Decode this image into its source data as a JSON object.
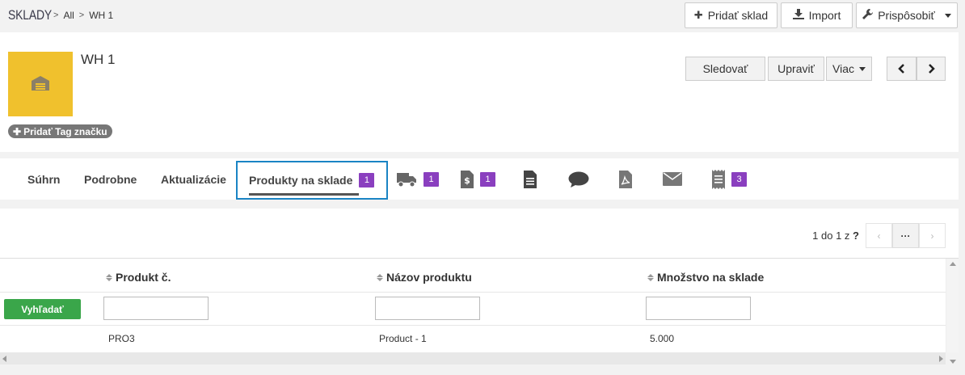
{
  "breadcrumb": {
    "module": "SKLADY",
    "all": "All",
    "current": "WH 1"
  },
  "toolbar": {
    "add_label": "Pridať sklad",
    "import_label": "Import",
    "customize_label": "Prispôsobiť"
  },
  "record": {
    "title": "WH 1",
    "tag_label": "Pridať Tag značku",
    "follow_label": "Sledovať",
    "edit_label": "Upraviť",
    "more_label": "Viac"
  },
  "tabs": [
    {
      "label": "Súhrn"
    },
    {
      "label": "Podrobne"
    },
    {
      "label": "Aktualizácie"
    },
    {
      "label": "Produkty na sklade",
      "badge": "1"
    },
    {
      "icon": "truck-icon",
      "badge": "1"
    },
    {
      "icon": "invoice-icon",
      "badge": "1"
    },
    {
      "icon": "document-icon"
    },
    {
      "icon": "comment-icon"
    },
    {
      "icon": "pdf-icon"
    },
    {
      "icon": "envelope-icon"
    },
    {
      "icon": "receipt-icon",
      "badge": "3"
    }
  ],
  "pager": {
    "text": "1 do 1  z",
    "q": "?",
    "mid": "···"
  },
  "grid": {
    "search_label": "Vyhľadať",
    "columns": [
      "Produkt č.",
      "Názov produktu",
      "Množstvo na sklade"
    ],
    "rows": [
      [
        "PRO3",
        "Product - 1",
        "5.000"
      ]
    ]
  },
  "colors": {
    "accent": "#1a84c4",
    "badge": "#8a3fbf",
    "search": "#3aa64a",
    "avatar": "#f0c12d"
  }
}
